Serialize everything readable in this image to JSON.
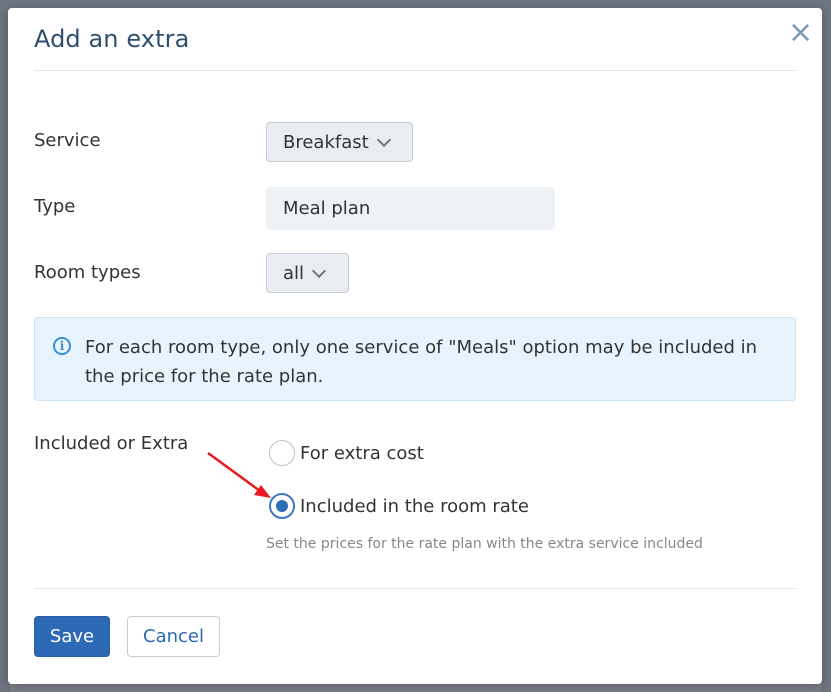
{
  "modal": {
    "title": "Add an extra",
    "close_glyph": "×"
  },
  "form": {
    "service_label": "Service",
    "service_value": "Breakfast",
    "type_label": "Type",
    "type_value": "Meal plan",
    "room_types_label": "Room types",
    "room_types_value": "all",
    "info_text": "For each room type, only one service of \"Meals\" option may be included in the price for the rate plan.",
    "included_label": "Included or Extra",
    "options": [
      {
        "label": "For extra cost",
        "selected": false
      },
      {
        "label": "Included in the room rate",
        "selected": true
      }
    ],
    "hint": "Set the prices for the rate plan with the extra service included"
  },
  "footer": {
    "save_label": "Save",
    "cancel_label": "Cancel"
  },
  "annotation": {
    "arrow_color": "#e8191f"
  },
  "icons": {
    "info": "info-circle-icon",
    "close": "close-icon",
    "chevron": "chevron-down-icon"
  },
  "colors": {
    "primary": "#2d69b5",
    "info_bg": "#e8f4fd",
    "title": "#2f4f6f"
  }
}
